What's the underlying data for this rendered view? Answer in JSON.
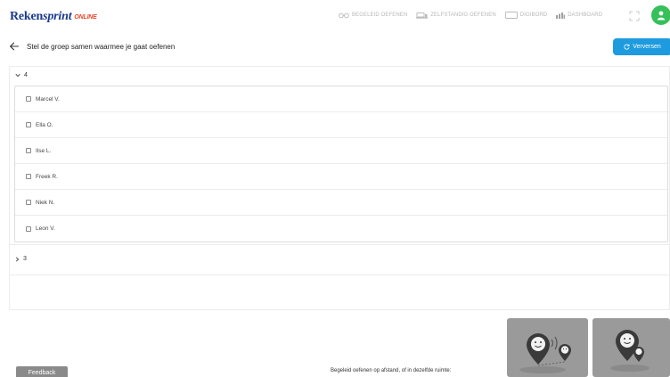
{
  "app": {
    "logo_main": "Reken",
    "logo_sprint": "sprint",
    "logo_online": "ONLINE"
  },
  "nav": {
    "items": [
      {
        "label": "BEGELEID OEFENEN",
        "icon": "guided-practice-icon"
      },
      {
        "label": "ZELFSTANDIG OEFENEN",
        "icon": "independent-practice-icon"
      },
      {
        "label": "DIGIBORD",
        "icon": "whiteboard-icon"
      },
      {
        "label": "DASHBOARD",
        "icon": "bar-chart-icon"
      }
    ]
  },
  "header": {
    "title": "Stel de groep samen waarmee je gaat oefenen",
    "refresh_label": "Verversen"
  },
  "groups": [
    {
      "label": "4",
      "expanded": true,
      "students": [
        "Marcel V.",
        "Ella O.",
        "Ilse L.",
        "Freek R.",
        "Niek N.",
        "Leon V."
      ]
    },
    {
      "label": "3",
      "expanded": false,
      "students": []
    }
  ],
  "footer": {
    "feedback_label": "Feedback",
    "caption": "Begeleid oefenen op afstand, of in dezelfde ruimte:"
  },
  "colors": {
    "brand": "#1a3a8a",
    "online": "#e8472a",
    "accent": "#1e9bdf",
    "avatar": "#36c05a",
    "tile": "#9a9a9a"
  }
}
